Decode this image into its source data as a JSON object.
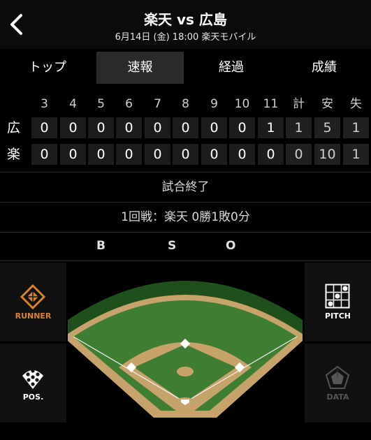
{
  "header": {
    "title": "楽天 vs 広島",
    "subtitle": "6月14日 (金) 18:00 楽天モバイル"
  },
  "tabs": [
    {
      "label": "トップ",
      "active": false
    },
    {
      "label": "速報",
      "active": true
    },
    {
      "label": "経過",
      "active": false
    },
    {
      "label": "成績",
      "active": false
    }
  ],
  "scoreboard": {
    "columns": [
      "3",
      "4",
      "5",
      "6",
      "7",
      "8",
      "9",
      "10",
      "11",
      "計",
      "安",
      "失"
    ],
    "rows": [
      {
        "team": "広",
        "values": [
          "0",
          "0",
          "0",
          "0",
          "0",
          "0",
          "0",
          "0",
          "1",
          "1",
          "5",
          "1"
        ]
      },
      {
        "team": "楽",
        "values": [
          "0",
          "0",
          "0",
          "0",
          "0",
          "0",
          "0",
          "0",
          "0",
          "0",
          "10",
          "1"
        ]
      }
    ]
  },
  "status": "試合終了",
  "series": "1回戦：楽天 0勝1敗0分",
  "count": {
    "b": "B",
    "s": "S",
    "o": "O"
  },
  "side": {
    "runner": "RUNNER",
    "pos": "POS.",
    "pitch": "PITCH",
    "data": "DATA"
  },
  "colors": {
    "runner_accent": "#d9822b",
    "grass": "#3e7d32",
    "dirt": "#c7a36c",
    "wall": "#1f4f1a"
  }
}
